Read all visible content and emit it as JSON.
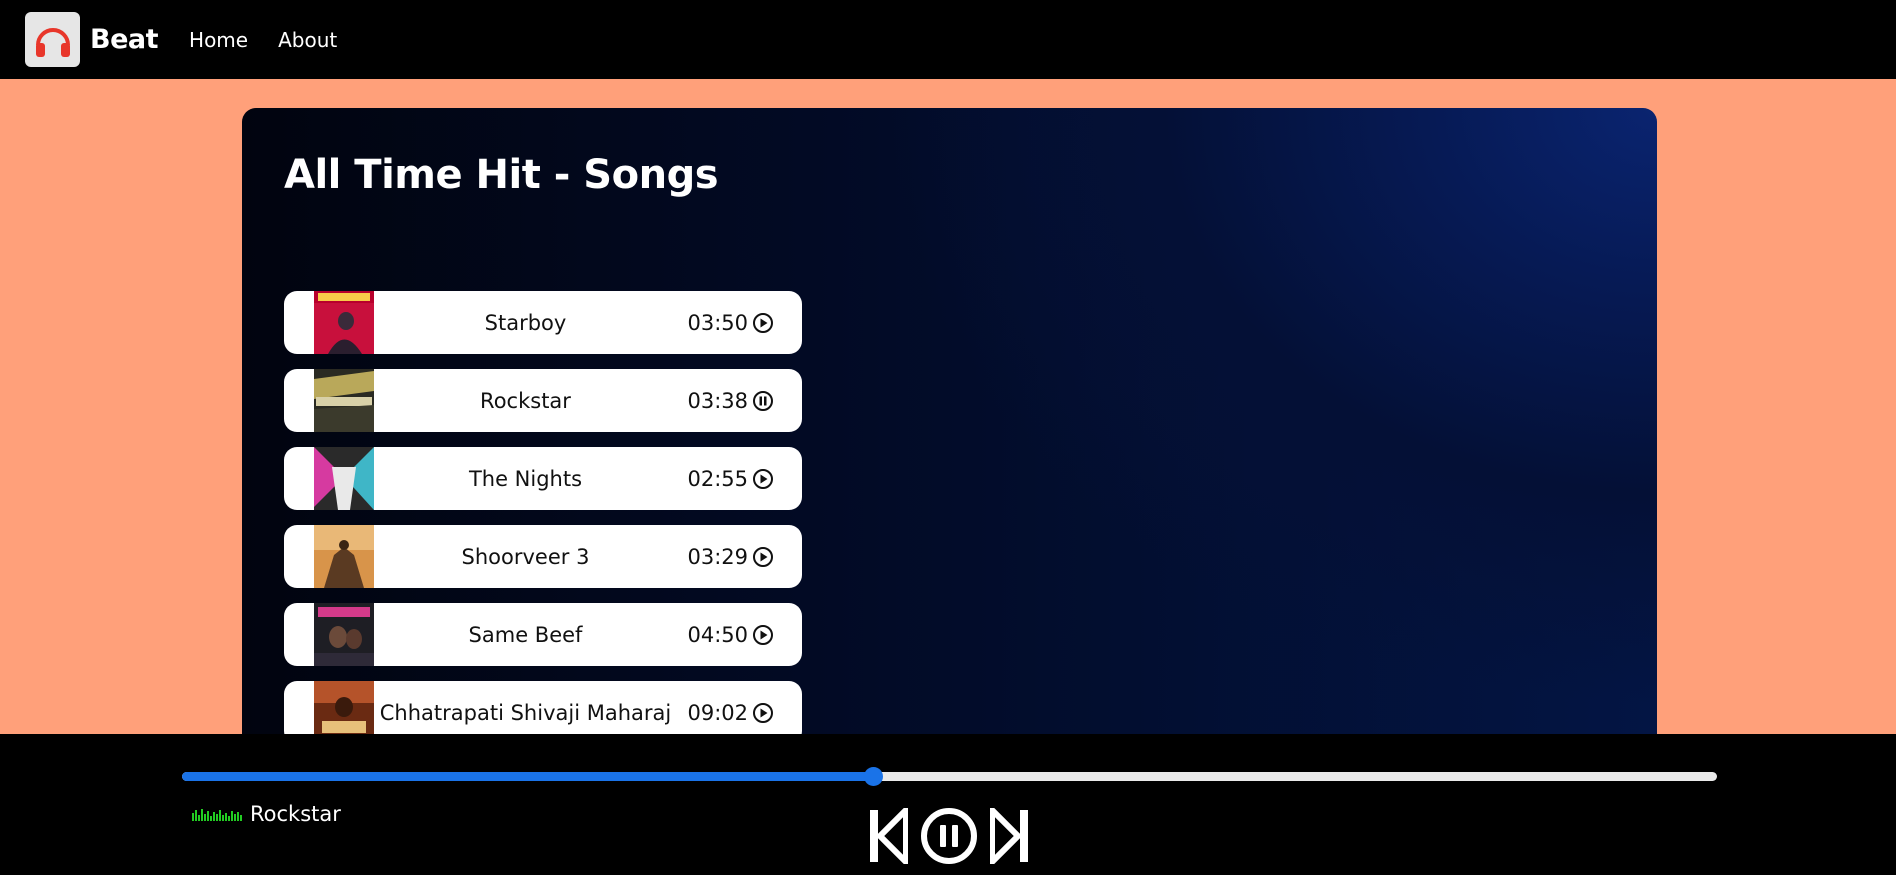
{
  "navbar": {
    "logo_icon": "headphones-icon",
    "brand": "Beat",
    "links": [
      "Home",
      "About"
    ]
  },
  "main": {
    "title": "All Time Hit - Songs",
    "songs": [
      {
        "name": "Starboy",
        "duration": "03:50",
        "status_icon": "play-circle-icon"
      },
      {
        "name": "Rockstar",
        "duration": "03:38",
        "status_icon": "pause-circle-icon"
      },
      {
        "name": "The Nights",
        "duration": "02:55",
        "status_icon": "play-circle-icon"
      },
      {
        "name": "Shoorveer 3",
        "duration": "03:29",
        "status_icon": "play-circle-icon"
      },
      {
        "name": "Same Beef",
        "duration": "04:50",
        "status_icon": "play-circle-icon"
      },
      {
        "name": "Chhatrapati Shivaji Maharaj",
        "duration": "09:02",
        "status_icon": "play-circle-icon"
      }
    ]
  },
  "player": {
    "progress_fraction": 0.45,
    "now_playing": "Rockstar",
    "controls": [
      "previous-icon",
      "pause-circle-icon",
      "next-icon"
    ]
  },
  "colors": {
    "page_bg": "#FFA07A",
    "navbar_bg": "#000000",
    "progress_accent": "#1a73e8",
    "eq_green": "#22cc22"
  }
}
